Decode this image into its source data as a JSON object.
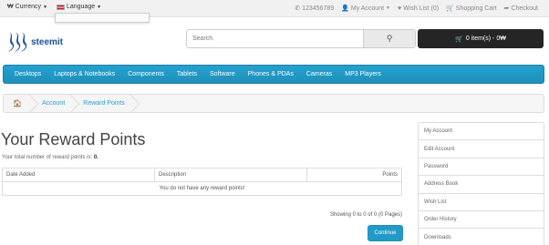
{
  "topbar": {
    "currency_label": "Currency",
    "currency_symbol": "₩",
    "language_label": "Language",
    "phone": "123456789",
    "my_account": "My Account",
    "wish_list": "Wish List (0)",
    "shopping_cart": "Shopping Cart",
    "checkout": "Checkout"
  },
  "header": {
    "logo_text": "steemit",
    "search_placeholder": "Search",
    "cart_label": "0 item(s) - 0₩"
  },
  "nav": {
    "items": [
      "Desktops",
      "Laptops & Notebooks",
      "Components",
      "Tablets",
      "Software",
      "Phones & PDAs",
      "Cameras",
      "MP3 Players"
    ]
  },
  "breadcrumb": {
    "items": [
      "Account",
      "Reward Points"
    ]
  },
  "content": {
    "title": "Your Reward Points",
    "total_text": "Your total number of reward points is:",
    "total_value": "0.",
    "table": {
      "headers": [
        "Date Added",
        "Description",
        "Points"
      ],
      "empty_message": "You do not have any reward points!"
    },
    "showing": "Showing 0 to 0 of 0 (0 Pages)",
    "continue_label": "Continue"
  },
  "sidebar": {
    "items": [
      "My Account",
      "Edit Account",
      "Password",
      "Address Book",
      "Wish List",
      "Order History",
      "Downloads"
    ]
  },
  "colors": {
    "accent": "#229ac8",
    "cart_bg": "#252525",
    "logo": "#1a5099"
  }
}
